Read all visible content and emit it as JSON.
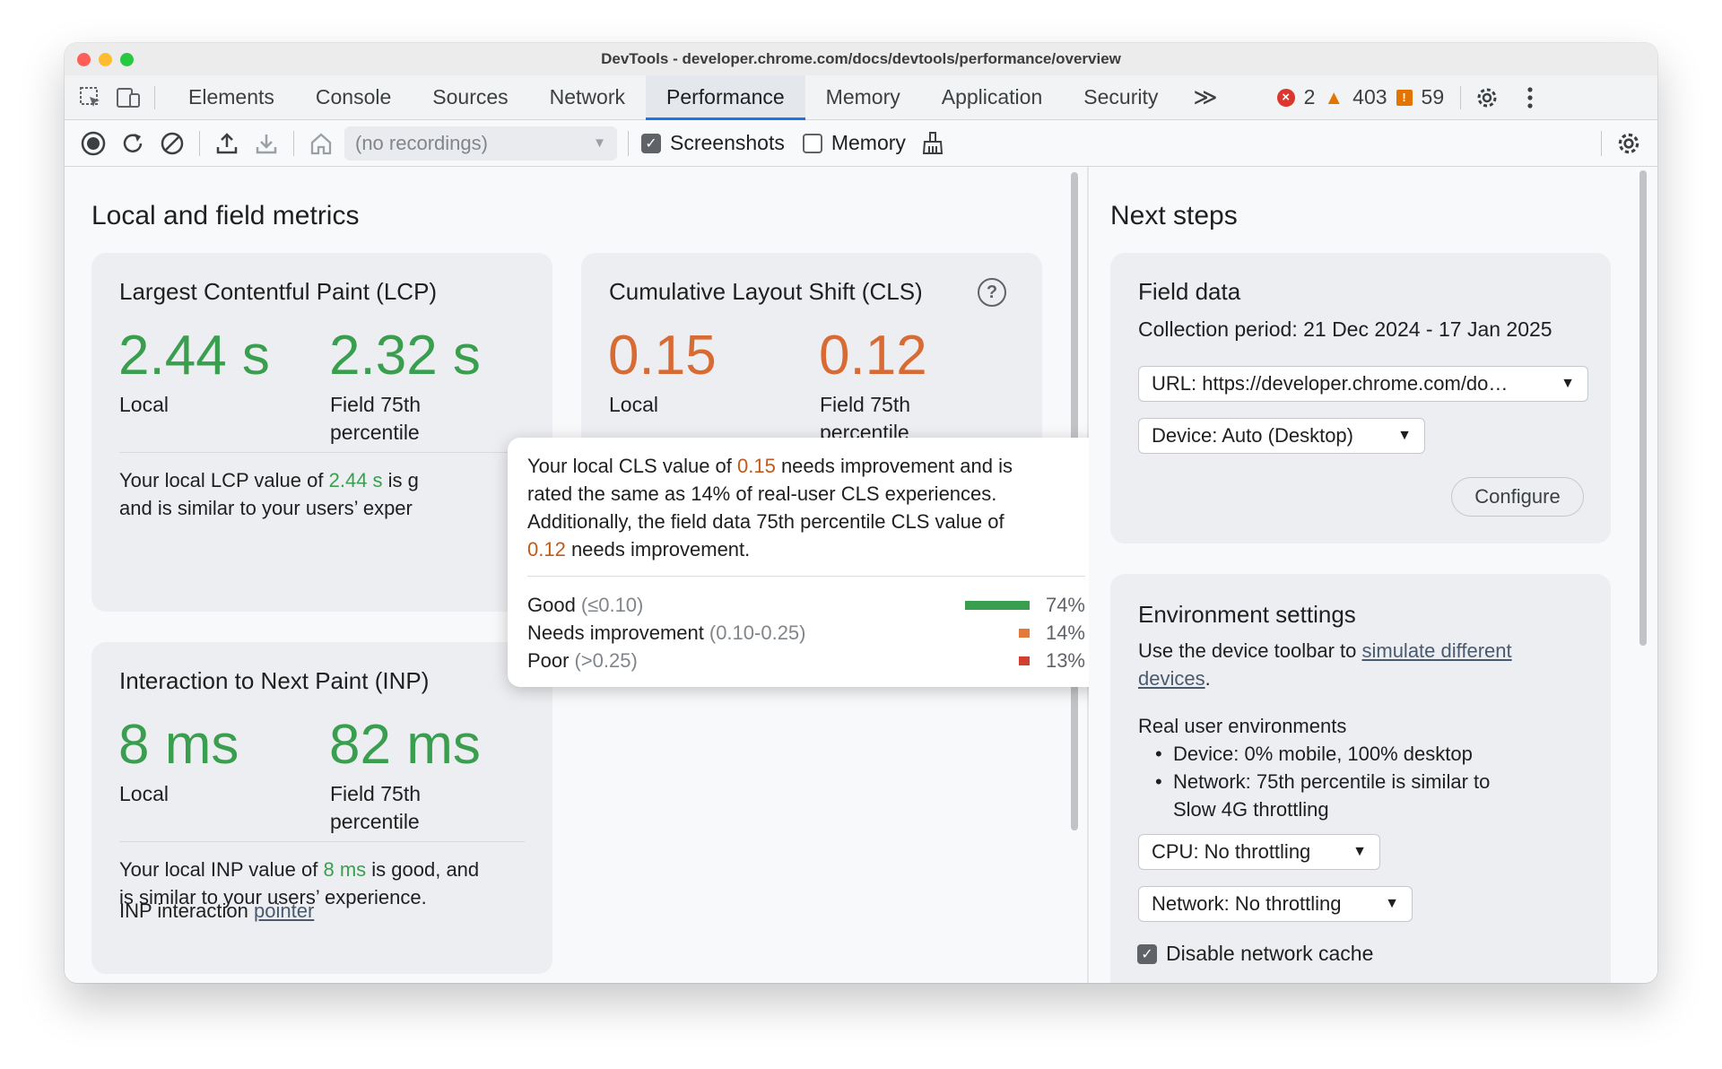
{
  "window": {
    "title": "DevTools - developer.chrome.com/docs/devtools/performance/overview"
  },
  "tabs": [
    {
      "label": "Elements"
    },
    {
      "label": "Console"
    },
    {
      "label": "Sources"
    },
    {
      "label": "Network"
    },
    {
      "label": "Performance",
      "active": true
    },
    {
      "label": "Memory"
    },
    {
      "label": "Application"
    },
    {
      "label": "Security"
    }
  ],
  "tabs_overflow": "≫",
  "counts": {
    "errors": "2",
    "warnings": "403",
    "issues": "59"
  },
  "toolbar": {
    "recordings_select": "(no recordings)",
    "screenshots_label": "Screenshots",
    "screenshots_checked": true,
    "memory_label": "Memory",
    "memory_checked": false
  },
  "left": {
    "section_title": "Local and field metrics",
    "lcp": {
      "title": "Largest Contentful Paint (LCP)",
      "local_value": "2.44 s",
      "local_label": "Local",
      "field_value": "2.32 s",
      "field_label_1": "Field 75th",
      "field_label_2": "percentile",
      "desc_1a": "Your local LCP value of ",
      "desc_1b": "2.44 s",
      "desc_1c": " is g",
      "desc_2": "and is similar to your users’ exper"
    },
    "cls": {
      "title": "Cumulative Layout Shift (CLS)",
      "local_value": "0.15",
      "local_label": "Local",
      "field_value": "0.12",
      "field_label_1": "Field 75th",
      "field_label_2": "percentile"
    },
    "inp": {
      "title": "Interaction to Next Paint (INP)",
      "local_value": "8 ms",
      "local_label": "Local",
      "field_value": "82 ms",
      "field_label_1": "Field 75th",
      "field_label_2": "percentile",
      "desc_a": "Your local INP value of ",
      "desc_b": "8 ms",
      "desc_c": " is good, and",
      "desc_2": "is similar to your users’ experience.",
      "interaction_label": "INP interaction ",
      "interaction_link": "pointer"
    }
  },
  "tooltip": {
    "l1a": "Your local CLS value of ",
    "l1b": "0.15",
    "l1c": " needs improvement and is",
    "l2": "rated the same as 14% of real-user CLS experiences.",
    "l3": "Additionally, the field data 75th percentile CLS value of",
    "l4a": "0.12",
    "l4b": " needs improvement.",
    "rows": [
      {
        "name": "Good",
        "range": "(≤0.10)",
        "pct": "74%",
        "fraction": 0.74,
        "color": "#3a9e4f"
      },
      {
        "name": "Needs improvement",
        "range": "(0.10-0.25)",
        "pct": "14%",
        "fraction": 0.14,
        "color": "#e37a3a"
      },
      {
        "name": "Poor",
        "range": "(>0.25)",
        "pct": "13%",
        "fraction": 0.13,
        "color": "#d23f31"
      }
    ]
  },
  "right": {
    "section_title": "Next steps",
    "field_data": {
      "title": "Field data",
      "period": "Collection period: 21 Dec 2024 - 17 Jan 2025",
      "url_select": "URL: https://developer.chrome.com/do…",
      "device_select": "Device: Auto (Desktop)",
      "configure": "Configure"
    },
    "env": {
      "title": "Environment settings",
      "desc_a": "Use the device toolbar to ",
      "desc_link_1": "simulate different",
      "desc_link_2": "devices",
      "desc_end": ".",
      "real_user_title": "Real user environments",
      "bullet_1": "Device: 0% mobile, 100% desktop",
      "bullet_2a": "Network: 75th percentile is similar to",
      "bullet_2b": "Slow 4G throttling",
      "cpu_select": "CPU: No throttling",
      "network_select": "Network: No throttling",
      "disable_cache": "Disable network cache",
      "disable_cache_checked": true
    }
  },
  "colors": {
    "good": "#3a9e4f",
    "needs_improvement": "#d86b34",
    "accent": "#1a73e8"
  }
}
